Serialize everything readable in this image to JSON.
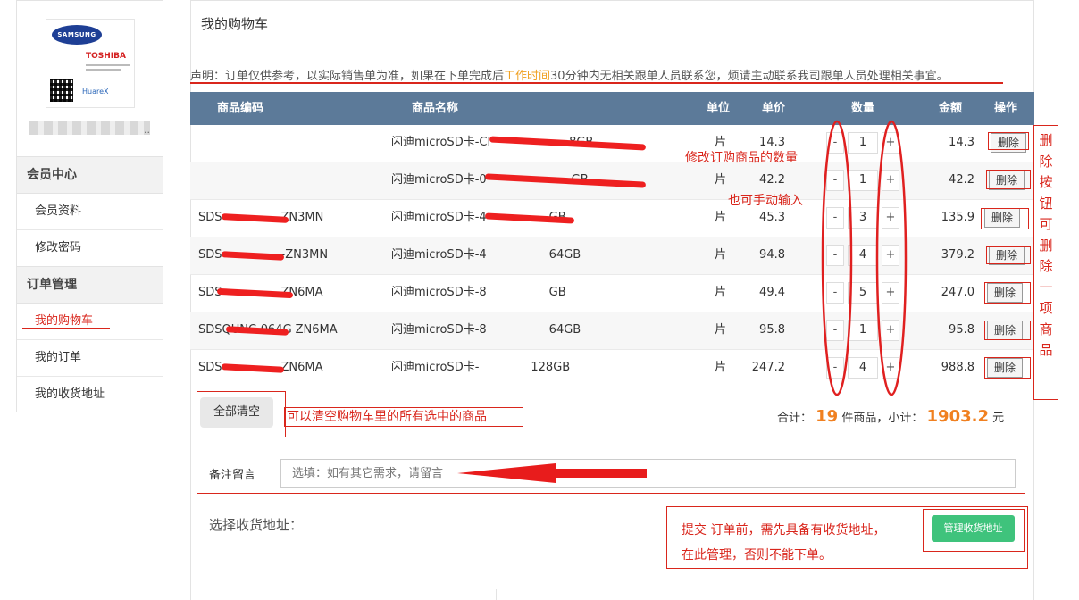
{
  "sidebar": {
    "logo": {
      "brand1": "SAMSUNG",
      "brand2": "TOSHIBA",
      "brand3": "HuareX"
    },
    "member_center": "会员中心",
    "member_items": [
      "会员资料",
      "修改密码"
    ],
    "order_management": "订单管理",
    "order_items": [
      "我的购物车",
      "我的订单",
      "我的收货地址"
    ]
  },
  "page_title": "我的购物车",
  "notice": {
    "before": "声明：订单仅供参考，以实际销售单为准，如果在下单完成后",
    "highlight": "工作时间",
    "after": "30分钟内无相关跟单人员联系您，烦请主动联系我司跟单人员处理相关事宜。"
  },
  "table": {
    "headers": {
      "code": "商品编码",
      "name": "商品名称",
      "unit": "单位",
      "price": "单价",
      "qty": "数量",
      "amount": "金额",
      "action": "操作"
    },
    "rows": [
      {
        "code": "",
        "name": "闪迪microSD卡-Cl",
        "name_tail": "8GB",
        "unit": "片",
        "price": "14.3",
        "qty": "1",
        "amount": "14.3"
      },
      {
        "code": "",
        "name": "闪迪microSD卡-0",
        "name_tail": "GB",
        "unit": "片",
        "price": "42.2",
        "qty": "1",
        "amount": "42.2"
      },
      {
        "code": "SDS",
        "code_tail": "ZN3MN",
        "name": "闪迪microSD卡-4",
        "name_tail": "GB",
        "unit": "片",
        "price": "45.3",
        "qty": "3",
        "amount": "135.9"
      },
      {
        "code": "SDS",
        "code_tail": "-ZN3MN",
        "name": "闪迪microSD卡-4",
        "name_tail": "64GB",
        "unit": "片",
        "price": "94.8",
        "qty": "4",
        "amount": "379.2"
      },
      {
        "code": "SDS",
        "code_tail": "ZN6MA",
        "name": "闪迪microSD卡-8",
        "name_tail": "GB",
        "unit": "片",
        "price": "49.4",
        "qty": "5",
        "amount": "247.0"
      },
      {
        "code": "SDSQUNC-064G",
        "code_tail": "ZN6MA",
        "name": "闪迪microSD卡-8",
        "name_tail": "64GB",
        "unit": "片",
        "price": "95.8",
        "qty": "1",
        "amount": "95.8"
      },
      {
        "code": "SDS",
        "code_tail": "ZN6MA",
        "name": "闪迪microSD卡-",
        "name_tail": "128GB",
        "unit": "片",
        "price": "247.2",
        "qty": "4",
        "amount": "988.8"
      }
    ],
    "minus": "-",
    "plus": "+",
    "delete_label": "删除"
  },
  "clear_all": "全部清空",
  "summary": {
    "total_label": "合计：",
    "count": "19",
    "count_suffix": "件商品，小计：",
    "subtotal": "1903.2",
    "currency": "元"
  },
  "remark": {
    "label": "备注留言",
    "placeholder": "选填：如有其它需求，请留言"
  },
  "address_label": "选择收货地址：",
  "manage_address": "管理收货地址",
  "annotations": {
    "qty_modify": "修改订购商品的数量",
    "qty_manual": "也可手动输入",
    "clear_note": "可以清空购物车里的所有选中的商品",
    "submit_line1": "提交 订单前，需先具备有收货地址，",
    "submit_line2": "在此管理，否则不能下单。",
    "delete_note": [
      "删",
      "除",
      "按",
      "钮",
      "可",
      "删",
      "除",
      "一",
      "项",
      "商",
      "品"
    ]
  }
}
